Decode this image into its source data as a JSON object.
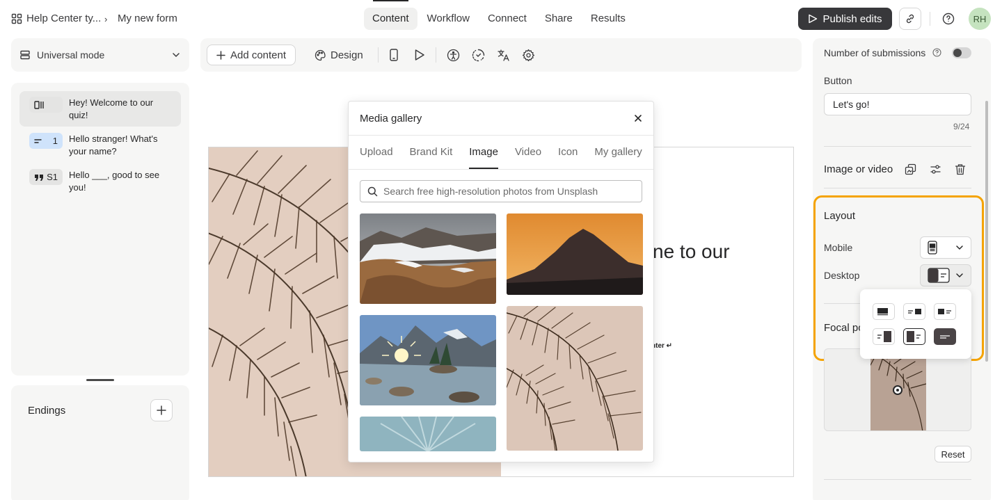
{
  "breadcrumb": {
    "workspace": "Help Center ty...",
    "separator": "›",
    "form": "My new form"
  },
  "top_tabs": [
    {
      "label": "Content",
      "active": true
    },
    {
      "label": "Workflow",
      "active": false
    },
    {
      "label": "Connect",
      "active": false
    },
    {
      "label": "Share",
      "active": false
    },
    {
      "label": "Results",
      "active": false
    }
  ],
  "header": {
    "publish_label": "Publish edits",
    "avatar_initials": "RH"
  },
  "left_panel": {
    "mode_label": "Universal mode",
    "questions": [
      {
        "badge": "",
        "text": "Hey! Welcome to our quiz!",
        "badge_color": "#e4e4e3",
        "selected": true
      },
      {
        "badge": "1",
        "text": "Hello stranger! What's your name?",
        "badge_color": "#cfe3fb",
        "selected": false
      },
      {
        "badge": "S1",
        "text": "Hello ___, good to see you!",
        "badge_color": "#e4e4e3",
        "selected": false
      }
    ],
    "endings_label": "Endings"
  },
  "toolbar": {
    "add_content_label": "Add content",
    "design_label": "Design"
  },
  "canvas": {
    "heading_partial": "ne to our",
    "hint_partial": "nter ↵"
  },
  "media_gallery": {
    "title": "Media gallery",
    "tabs": [
      {
        "label": "Upload",
        "active": false
      },
      {
        "label": "Brand Kit",
        "active": false
      },
      {
        "label": "Image",
        "active": true
      },
      {
        "label": "Video",
        "active": false
      },
      {
        "label": "Icon",
        "active": false
      },
      {
        "label": "My gallery",
        "active": false
      }
    ],
    "search_placeholder": "Search free high-resolution photos from Unsplash"
  },
  "right_panel": {
    "submissions_label": "Number of submissions",
    "button_section_label": "Button",
    "button_value": "Let's go!",
    "char_count": "9/24",
    "image_section_label": "Image or video",
    "layout_label": "Layout",
    "mobile_label": "Mobile",
    "desktop_label": "Desktop",
    "focal_label": "Focal po",
    "reset_label": "Reset"
  },
  "colors": {
    "accent_highlight": "#f5a300",
    "publish_bg": "#38383b",
    "avatar_bg": "#c5e3bf",
    "panel_bg": "#f6f6f5"
  }
}
